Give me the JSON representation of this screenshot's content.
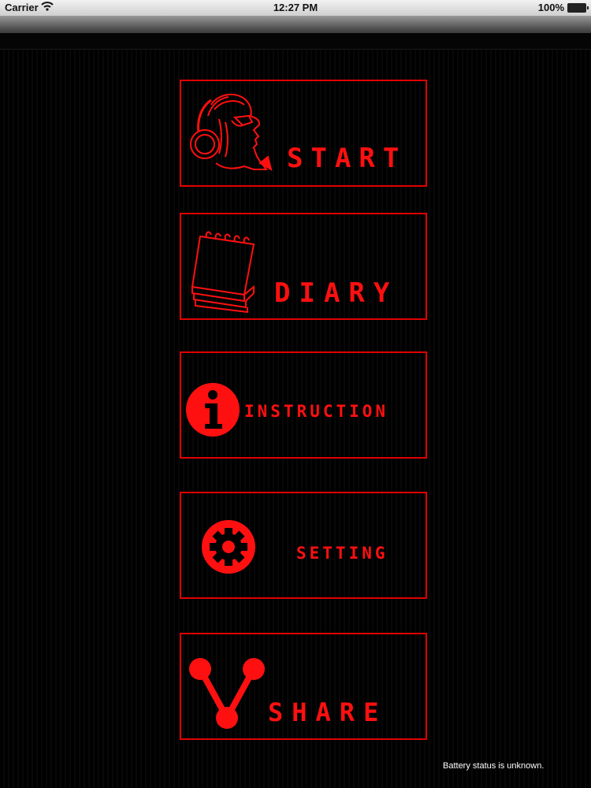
{
  "status_bar": {
    "carrier": "Carrier",
    "time": "12:27 PM",
    "battery": "100%"
  },
  "menu": [
    {
      "id": "start",
      "label": "START",
      "icon": "headphones-face-icon"
    },
    {
      "id": "diary",
      "label": "DIARY",
      "icon": "notepad-icon"
    },
    {
      "id": "instruction",
      "label": "INSTRUCTION",
      "icon": "info-icon"
    },
    {
      "id": "setting",
      "label": "SETTING",
      "icon": "gear-icon"
    },
    {
      "id": "share",
      "label": "SHARE",
      "icon": "share-icon"
    }
  ],
  "footer": {
    "battery_message": "Battery status is unknown."
  },
  "colors": {
    "accent": "#ff0000",
    "background": "#000000"
  }
}
